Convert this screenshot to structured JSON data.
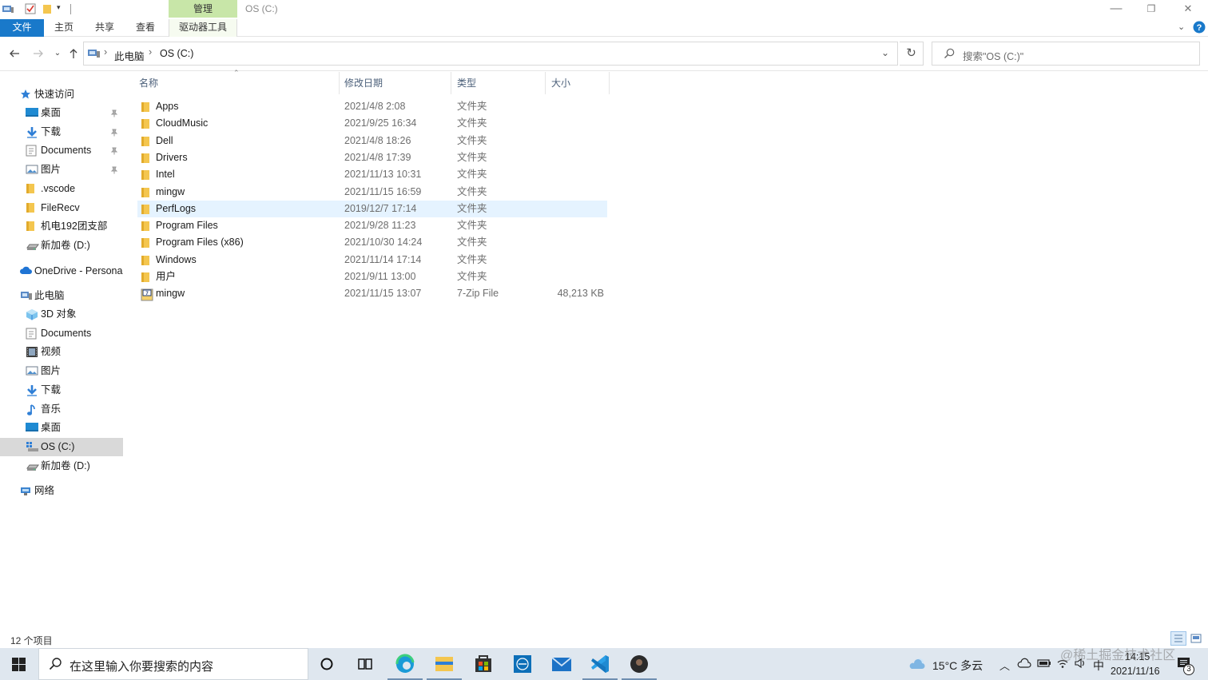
{
  "window": {
    "title": "OS (C:)",
    "context_tab": "管理",
    "minimize": "—",
    "restore": "❐",
    "close": "✕"
  },
  "ribbon": {
    "tabs": [
      "文件",
      "主页",
      "共享",
      "查看",
      "驱动器工具"
    ]
  },
  "address": {
    "breadcrumb": [
      "此电脑",
      "OS (C:)"
    ],
    "separator": "›",
    "search_placeholder": "搜索\"OS (C:)\""
  },
  "nav": {
    "quick_access": "快速访问",
    "quick_items": [
      {
        "label": "桌面",
        "icon": "desktop-icon",
        "pinned": true
      },
      {
        "label": "下载",
        "icon": "download-icon",
        "pinned": true
      },
      {
        "label": "Documents",
        "icon": "document-icon",
        "pinned": true
      },
      {
        "label": "图片",
        "icon": "pictures-icon",
        "pinned": true
      },
      {
        "label": ".vscode",
        "icon": "folder-icon",
        "pinned": false
      },
      {
        "label": "FileRecv",
        "icon": "folder-icon",
        "pinned": false
      },
      {
        "label": "机电192团支部",
        "icon": "folder-icon",
        "pinned": false
      },
      {
        "label": "新加卷 (D:)",
        "icon": "drive-icon",
        "pinned": false
      }
    ],
    "onedrive": "OneDrive - Persona",
    "this_pc": "此电脑",
    "pc_items": [
      {
        "label": "3D 对象",
        "icon": "3d-objects-icon"
      },
      {
        "label": "Documents",
        "icon": "document-icon"
      },
      {
        "label": "视频",
        "icon": "video-icon"
      },
      {
        "label": "图片",
        "icon": "pictures-icon"
      },
      {
        "label": "下载",
        "icon": "download-icon"
      },
      {
        "label": "音乐",
        "icon": "music-icon"
      },
      {
        "label": "桌面",
        "icon": "desktop-icon"
      },
      {
        "label": "OS (C:)",
        "icon": "windows-drive-icon",
        "selected": true
      },
      {
        "label": "新加卷 (D:)",
        "icon": "drive-icon"
      }
    ],
    "network": "网络",
    "pin_glyph": "📌"
  },
  "columns": {
    "name": "名称",
    "modified": "修改日期",
    "type": "类型",
    "size": "大小"
  },
  "files": [
    {
      "name": "Apps",
      "modified": "2021/4/8 2:08",
      "type": "文件夹",
      "size": "",
      "icon": "folder-icon"
    },
    {
      "name": "CloudMusic",
      "modified": "2021/9/25 16:34",
      "type": "文件夹",
      "size": "",
      "icon": "folder-icon"
    },
    {
      "name": "Dell",
      "modified": "2021/4/8 18:26",
      "type": "文件夹",
      "size": "",
      "icon": "folder-icon"
    },
    {
      "name": "Drivers",
      "modified": "2021/4/8 17:39",
      "type": "文件夹",
      "size": "",
      "icon": "folder-icon"
    },
    {
      "name": "Intel",
      "modified": "2021/11/13 10:31",
      "type": "文件夹",
      "size": "",
      "icon": "folder-icon"
    },
    {
      "name": "mingw",
      "modified": "2021/11/15 16:59",
      "type": "文件夹",
      "size": "",
      "icon": "folder-icon"
    },
    {
      "name": "PerfLogs",
      "modified": "2019/12/7 17:14",
      "type": "文件夹",
      "size": "",
      "icon": "folder-icon",
      "selected": true
    },
    {
      "name": "Program Files",
      "modified": "2021/9/28 11:23",
      "type": "文件夹",
      "size": "",
      "icon": "folder-icon"
    },
    {
      "name": "Program Files (x86)",
      "modified": "2021/10/30 14:24",
      "type": "文件夹",
      "size": "",
      "icon": "folder-icon"
    },
    {
      "name": "Windows",
      "modified": "2021/11/14 17:14",
      "type": "文件夹",
      "size": "",
      "icon": "folder-icon"
    },
    {
      "name": "用户",
      "modified": "2021/9/11 13:00",
      "type": "文件夹",
      "size": "",
      "icon": "folder-icon"
    },
    {
      "name": "mingw",
      "modified": "2021/11/15 13:07",
      "type": "7-Zip File",
      "size": "48,213 KB",
      "icon": "archive-icon"
    }
  ],
  "status": {
    "count": "12 个项目"
  },
  "taskbar": {
    "search_placeholder": "在这里输入你要搜索的内容",
    "apps": [
      "cortana-icon",
      "task-view-icon",
      "edge-icon",
      "file-explorer-icon",
      "store-icon",
      "dell-icon",
      "mail-icon",
      "vscode-icon",
      "music-app-icon"
    ],
    "weather": "15°C  多云",
    "ime": "中",
    "time": "14:15",
    "date": "2021/11/16",
    "notifications": "3"
  },
  "watermark": "@稀土掘金技术社区",
  "colors": {
    "accent": "#1979ca",
    "selection": "#e5f3ff",
    "folder": "#f4c64f",
    "context_tab": "#c8e6a8"
  }
}
